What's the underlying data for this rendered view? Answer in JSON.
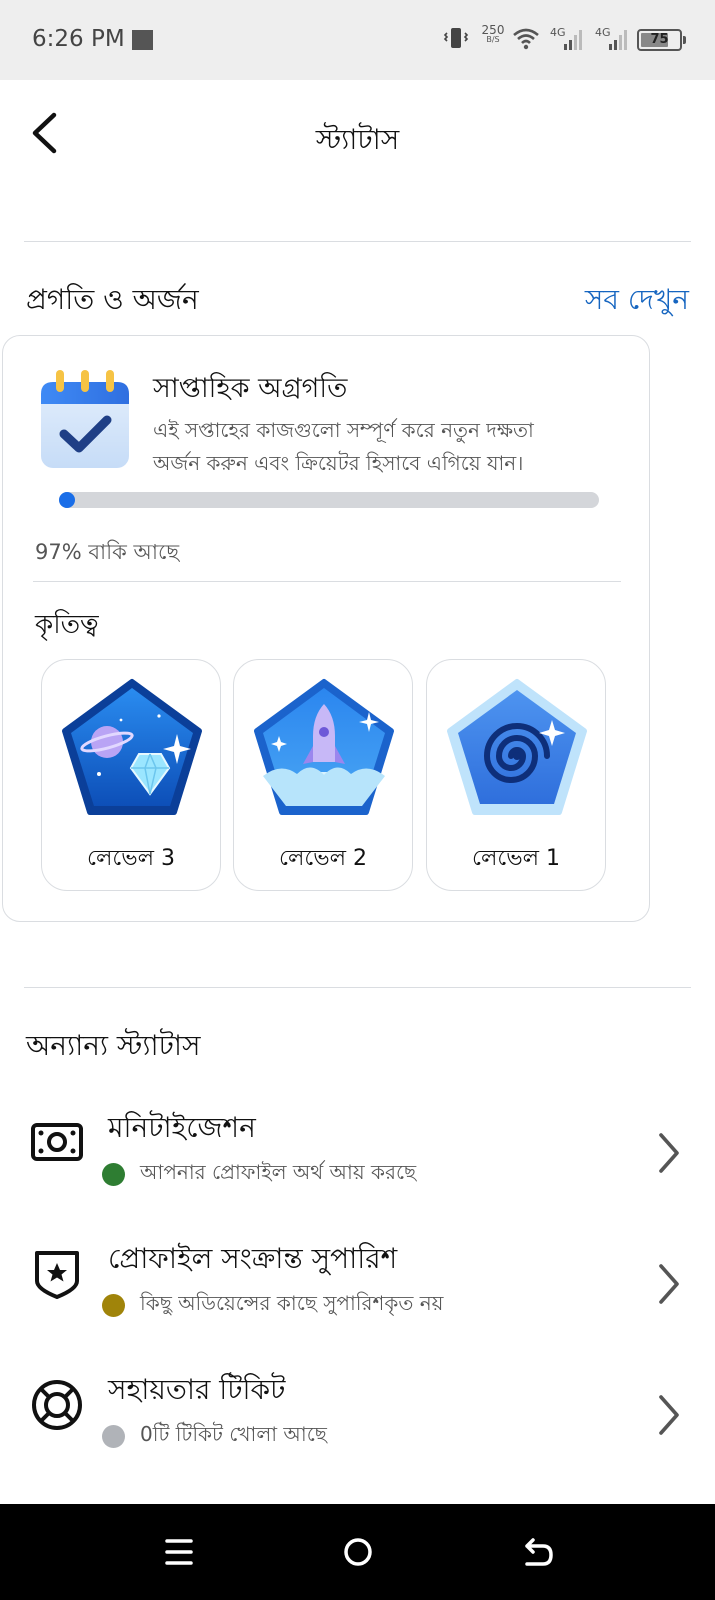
{
  "status_bar": {
    "time": "6:26 PM",
    "net_speed": "250",
    "net_unit": "B/S",
    "sim1": "4G",
    "sim2": "4G",
    "battery": "75",
    "battery_level": 0.75
  },
  "header": {
    "title": "স্ট্যাটাস",
    "back_icon": "chevron-left-icon"
  },
  "progress_section": {
    "title": "প্রগতি ও অর্জন",
    "see_all": "সব দেখুন"
  },
  "weekly_progress": {
    "icon": "calendar-check-icon",
    "title": "সাপ্তাহিক অগ্রগতি",
    "description_line1": "এই সপ্তাহের কাজগুলো সম্পূর্ণ করে নতুন দক্ষতা",
    "description_line2": "অর্জন করুন এবং ক্রিয়েটর হিসাবে এগিয়ে যান।",
    "progress": 0.03,
    "remaining_text": "97% বাকি আছে"
  },
  "achievements": {
    "title": "কৃতিত্ব",
    "badges": [
      {
        "label": "লেভেল 3",
        "icon": "planet-diamond-badge-icon"
      },
      {
        "label": "লেভেল 2",
        "icon": "rocket-badge-icon"
      },
      {
        "label": "লেভেল 1",
        "icon": "galaxy-badge-icon"
      }
    ]
  },
  "other_status": {
    "title": "অন্যান্য স্ট্যাটাস",
    "items": [
      {
        "title": "মনিটাইজেশন",
        "subtitle": "আপনার প্রোফাইল অর্থ আয় করছে",
        "status_color": "#2e7d32",
        "icon": "money-icon"
      },
      {
        "title": "প্রোফাইল সংক্রান্ত সুপারিশ",
        "subtitle": "কিছু অডিয়েন্সের কাছে সুপারিশকৃত নয়",
        "status_color": "#a0840a",
        "icon": "shield-star-icon"
      },
      {
        "title": "সহায়তার টিকিট",
        "subtitle": "0টি টিকিট খোলা আছে",
        "status_color": "#b0b3b8",
        "icon": "lifebuoy-icon"
      }
    ]
  },
  "nav_bar": {
    "menu_icon": "menu-icon",
    "home_icon": "home-circle-icon",
    "back_icon": "back-arrow-icon"
  },
  "colors": {
    "accent": "#1565c0",
    "progress": "#1a6ee8"
  }
}
